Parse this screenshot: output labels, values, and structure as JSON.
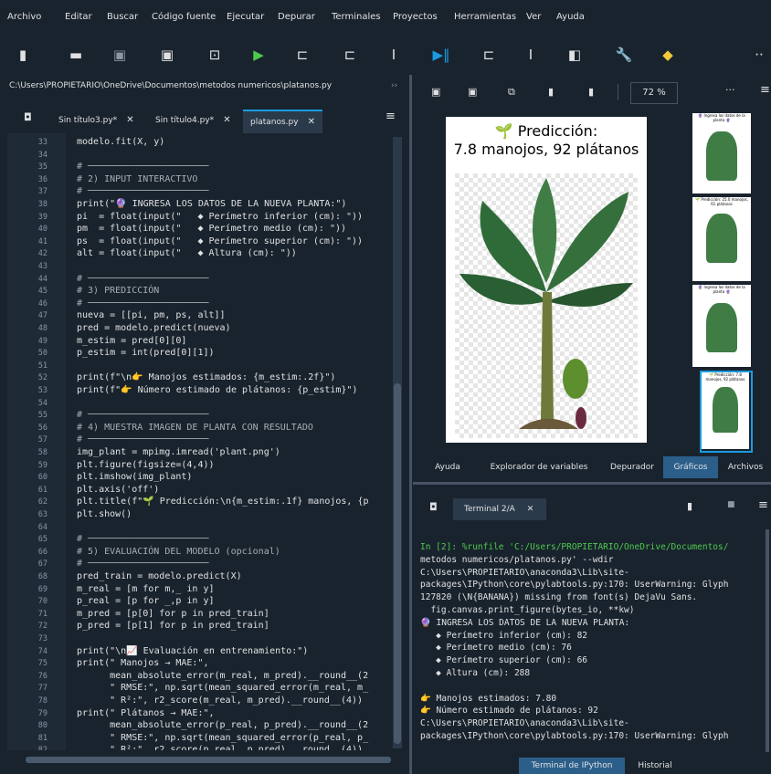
{
  "menu": [
    "Archivo",
    "Editar",
    "Buscar",
    "Código fuente",
    "Ejecutar",
    "Depurar",
    "Terminales",
    "Proyectos",
    "Herramientas",
    "Ver",
    "Ayuda"
  ],
  "toolbar_icons": [
    "new-file-icon",
    "open-folder-icon",
    "save-icon",
    "save-all-icon",
    "new-cell-icon",
    "run-icon",
    "run-cell-icon",
    "run-cell-advance-icon",
    "run-selection-icon",
    "debug-icon",
    "debug-cell-icon",
    "debug-selection-icon",
    "maximize-pane-icon",
    "preferences-icon",
    "python-path-icon",
    "more-icon"
  ],
  "editor": {
    "path": "C:\\Users\\PROPIETARIO\\OneDrive\\Documentos\\metodos numericos\\platanos.py",
    "path_arrow": "››",
    "tabs": [
      {
        "label": "Sin título3.py*"
      },
      {
        "label": "Sin título4.py*"
      },
      {
        "label": "platanos.py"
      }
    ],
    "tab_close": "✕",
    "menu_glyph": "≡",
    "lines": [
      {
        "n": "33",
        "t": "modelo.fit(X, y)"
      },
      {
        "n": "34",
        "t": ""
      },
      {
        "n": "35",
        "t": "# ──────────────────────"
      },
      {
        "n": "36",
        "t": "# 2) INPUT INTERACTIVO"
      },
      {
        "n": "37",
        "t": "# ──────────────────────"
      },
      {
        "n": "38",
        "t": "print(\"🔮 INGRESA LOS DATOS DE LA NUEVA PLANTA:\")"
      },
      {
        "n": "39",
        "t": "pi  = float(input(\"   ◆ Perímetro inferior (cm): \"))"
      },
      {
        "n": "40",
        "t": "pm  = float(input(\"   ◆ Perímetro medio (cm): \"))"
      },
      {
        "n": "41",
        "t": "ps  = float(input(\"   ◆ Perímetro superior (cm): \"))"
      },
      {
        "n": "42",
        "t": "alt = float(input(\"   ◆ Altura (cm): \"))"
      },
      {
        "n": "43",
        "t": ""
      },
      {
        "n": "44",
        "t": "# ──────────────────────"
      },
      {
        "n": "45",
        "t": "# 3) PREDICCIÓN"
      },
      {
        "n": "46",
        "t": "# ──────────────────────"
      },
      {
        "n": "47",
        "t": "nueva = [[pi, pm, ps, alt]]"
      },
      {
        "n": "48",
        "t": "pred = modelo.predict(nueva)"
      },
      {
        "n": "49",
        "t": "m_estim = pred[0][0]"
      },
      {
        "n": "50",
        "t": "p_estim = int(pred[0][1])"
      },
      {
        "n": "51",
        "t": ""
      },
      {
        "n": "52",
        "t": "print(f\"\\n👉 Manojos estimados: {m_estim:.2f}\")"
      },
      {
        "n": "53",
        "t": "print(f\"👉 Número estimado de plátanos: {p_estim}\")"
      },
      {
        "n": "54",
        "t": ""
      },
      {
        "n": "55",
        "t": "# ──────────────────────"
      },
      {
        "n": "56",
        "t": "# 4) MUESTRA IMAGEN DE PLANTA CON RESULTADO"
      },
      {
        "n": "57",
        "t": "# ──────────────────────"
      },
      {
        "n": "58",
        "t": "img_plant = mpimg.imread('plant.png')"
      },
      {
        "n": "59",
        "t": "plt.figure(figsize=(4,4))"
      },
      {
        "n": "60",
        "t": "plt.imshow(img_plant)"
      },
      {
        "n": "61",
        "t": "plt.axis('off')"
      },
      {
        "n": "62",
        "t": "plt.title(f\"🌱 Predicción:\\n{m_estim:.1f} manojos, {p"
      },
      {
        "n": "63",
        "t": "plt.show()"
      },
      {
        "n": "64",
        "t": ""
      },
      {
        "n": "65",
        "t": "# ──────────────────────"
      },
      {
        "n": "66",
        "t": "# 5) EVALUACIÓN DEL MODELO (opcional)"
      },
      {
        "n": "67",
        "t": "# ──────────────────────"
      },
      {
        "n": "68",
        "t": "pred_train = modelo.predict(X)"
      },
      {
        "n": "69",
        "t": "m_real = [m for m,_ in y]"
      },
      {
        "n": "70",
        "t": "p_real = [p for _,p in y]"
      },
      {
        "n": "71",
        "t": "m_pred = [p[0] for p in pred_train]"
      },
      {
        "n": "72",
        "t": "p_pred = [p[1] for p in pred_train]"
      },
      {
        "n": "73",
        "t": ""
      },
      {
        "n": "74",
        "t": "print(\"\\n📈 Evaluación en entrenamiento:\")"
      },
      {
        "n": "75",
        "t": "print(\" Manojos → MAE:\","
      },
      {
        "n": "76",
        "t": "      mean_absolute_error(m_real, m_pred).__round__(2"
      },
      {
        "n": "77",
        "t": "      \" RMSE:\", np.sqrt(mean_squared_error(m_real, m_"
      },
      {
        "n": "78",
        "t": "      \" R²:\", r2_score(m_real, m_pred).__round__(4))"
      },
      {
        "n": "79",
        "t": "print(\" Plátanos → MAE:\","
      },
      {
        "n": "80",
        "t": "      mean_absolute_error(p_real, p_pred).__round__(2"
      },
      {
        "n": "81",
        "t": "      \" RMSE:\", np.sqrt(mean_squared_error(p_real, p_"
      },
      {
        "n": "82",
        "t": "      \" R²:\", r2_score(p_real, p_pred).__round__(4))"
      }
    ]
  },
  "plots": {
    "zoom": "72 %",
    "toolbar_icons": [
      "save-plot-icon",
      "save-all-plots-icon",
      "copy-plot-icon",
      "remove-plot-icon",
      "remove-all-plots-icon"
    ],
    "more": "···",
    "menu_glyph": "≡",
    "figure_title_line1": "🌱 Predicción:",
    "figure_title_line2": "7.8 manojos, 92 plátanos",
    "thumb_titles": [
      "🔮 Ingresa los datos de la planta 🔮",
      "🌱 Predicción: 25.0 manojos, 61 plátanos",
      "🔮 Ingresa los datos de la planta 🔮",
      "🌱 Predicción: 7.8 manojos, 92 plátanos"
    ],
    "pane_tabs": [
      "Ayuda",
      "Explorador de variables",
      "Depurador",
      "Gráficos",
      "Archivos"
    ],
    "active_pane_tab": "Gráficos"
  },
  "console": {
    "tab_label": "Terminal 2/A",
    "tab_close": "✕",
    "lines": [
      "In [2]: %runfile 'C:/Users/PROPIETARIO/OneDrive/Documentos/",
      "metodos numericos/platanos.py' --wdir",
      "C:\\Users\\PROPIETARIO\\anaconda3\\Lib\\site-",
      "packages\\IPython\\core\\pylabtools.py:170: UserWarning: Glyph",
      "127820 (\\N{BANANA}) missing from font(s) DejaVu Sans.",
      "  fig.canvas.print_figure(bytes_io, **kw)",
      "🔮 INGRESA LOS DATOS DE LA NUEVA PLANTA:",
      "   ◆ Perímetro inferior (cm): 82",
      "   ◆ Perímetro medio (cm): 76",
      "   ◆ Perímetro superior (cm): 66",
      "   ◆ Altura (cm): 288",
      "",
      "👉 Manojos estimados: 7.80",
      "👉 Número estimado de plátanos: 92",
      "C:\\Users\\PROPIETARIO\\anaconda3\\Lib\\site-",
      "packages\\IPython\\core\\pylabtools.py:170: UserWarning: Glyph"
    ],
    "bottom_tabs": [
      "Terminal de IPython",
      "Historial"
    ],
    "active_bottom_tab": "Terminal de IPython"
  }
}
